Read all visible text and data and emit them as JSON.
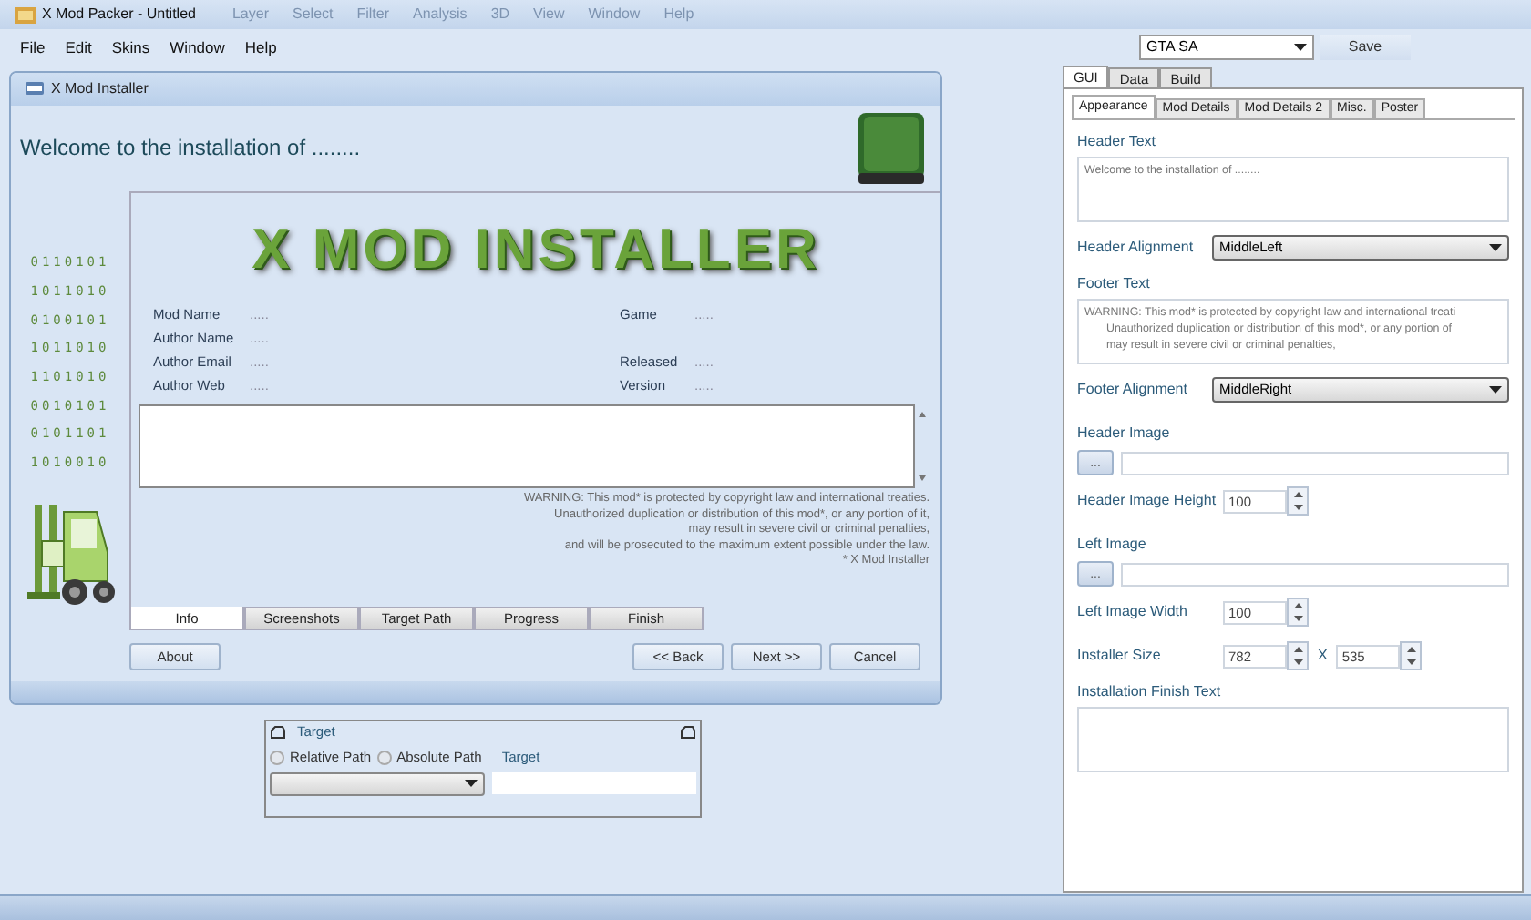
{
  "window": {
    "title": "X Mod Packer - Untitled",
    "background_menu": [
      "Layer",
      "Select",
      "Filter",
      "Analysis",
      "3D",
      "View",
      "Window",
      "Help"
    ]
  },
  "menu": [
    "File",
    "Edit",
    "Skins",
    "Window",
    "Help"
  ],
  "game_select": {
    "value": "GTA SA"
  },
  "save_button": "Save",
  "installer": {
    "title": "X Mod Installer",
    "heading": "Welcome to the installation of ........",
    "binary": [
      "0110101",
      "1011010",
      "0100101",
      "1011010",
      "1101010",
      "0010101",
      "0101101",
      "1010010"
    ],
    "logo": "X MOD INSTALLER",
    "details": [
      {
        "label": "Mod Name",
        "value": ".....",
        "side_label": "Game",
        "side_value": "....."
      },
      {
        "label": "Author Name",
        "value": "....."
      },
      {
        "label": "Author Email",
        "value": ".....",
        "side_label": "Released",
        "side_value": "....."
      },
      {
        "label": "Author Web",
        "value": ".....",
        "side_label": "Version",
        "side_value": "....."
      }
    ],
    "warning": [
      "WARNING: This mod* is protected by copyright law and international treaties.",
      "Unauthorized duplication or distribution of this mod*, or any portion of it,",
      "may result in severe civil or criminal penalties,",
      "and will be prosecuted to the maximum extent possible under the law.",
      "* X Mod Installer"
    ],
    "tabs": [
      {
        "label": "Info",
        "selected": true
      },
      {
        "label": "Screenshots",
        "selected": false
      },
      {
        "label": "Target Path",
        "selected": false
      },
      {
        "label": "Progress",
        "selected": false
      },
      {
        "label": "Finish",
        "selected": false
      }
    ],
    "about_button": "About",
    "nav_buttons": [
      "<< Back",
      "Next >>",
      "Cancel"
    ]
  },
  "target_group": {
    "title": "Target",
    "radios": [
      {
        "label": "Relative Path",
        "selected": false
      },
      {
        "label": "Absolute Path",
        "selected": false
      }
    ],
    "field_label": "Target"
  },
  "outer_tabs": [
    {
      "label": "GUI",
      "selected": true
    },
    {
      "label": "Data",
      "selected": false
    },
    {
      "label": "Build",
      "selected": false
    }
  ],
  "inner_tabs": [
    {
      "label": "Appearance",
      "selected": true
    },
    {
      "label": "Mod Details",
      "selected": false
    },
    {
      "label": "Mod Details 2",
      "selected": false
    },
    {
      "label": "Misc.",
      "selected": false
    },
    {
      "label": "Poster",
      "selected": false
    }
  ],
  "form": [
    {
      "kind": "textarea",
      "label": "Header Text",
      "lines": [
        "Welcome to the installation of ........"
      ]
    },
    {
      "kind": "select",
      "label": "Header Alignment",
      "value": "MiddleLeft"
    },
    {
      "kind": "textarea",
      "label": "Footer Text",
      "lines": [
        "WARNING: This mod* is protected by copyright law and international treati",
        "Unauthorized duplication or distribution of this mod*, or any portion of",
        "may result in severe civil or criminal penalties,"
      ]
    },
    {
      "kind": "select",
      "label": "Footer Alignment",
      "value": "MiddleRight"
    },
    {
      "kind": "image",
      "label": "Header Image",
      "button": "..."
    },
    {
      "kind": "spinner",
      "label": "Header Image Height",
      "value": "100"
    },
    {
      "kind": "image",
      "label": "Left Image",
      "button": "..."
    },
    {
      "kind": "spinner",
      "label": "Left Image Width",
      "value": "100"
    },
    {
      "kind": "size",
      "label": "Installer Size",
      "value": "782",
      "separator": "X",
      "value2": "535"
    },
    {
      "kind": "textarea",
      "label": "Installation Finish Text"
    }
  ]
}
